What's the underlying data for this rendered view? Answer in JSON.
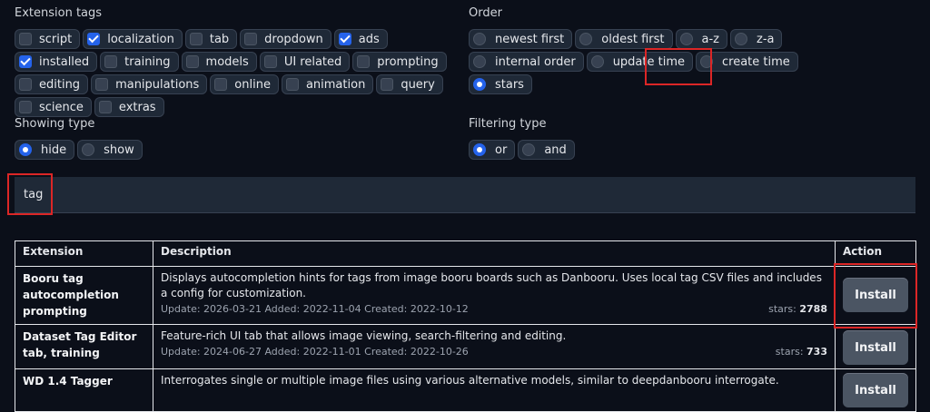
{
  "extension_tags": {
    "label": "Extension tags",
    "rows": [
      [
        {
          "label": "script",
          "checked": false
        },
        {
          "label": "localization",
          "checked": true
        },
        {
          "label": "tab",
          "checked": false
        },
        {
          "label": "dropdown",
          "checked": false
        },
        {
          "label": "ads",
          "checked": true
        },
        {
          "label": "installed",
          "checked": true
        }
      ],
      [
        {
          "label": "training",
          "checked": false
        },
        {
          "label": "models",
          "checked": false
        },
        {
          "label": "UI related",
          "checked": false
        },
        {
          "label": "prompting",
          "checked": false
        },
        {
          "label": "editing",
          "checked": false
        }
      ],
      [
        {
          "label": "manipulations",
          "checked": false
        },
        {
          "label": "online",
          "checked": false
        },
        {
          "label": "animation",
          "checked": false
        },
        {
          "label": "query",
          "checked": false
        },
        {
          "label": "science",
          "checked": false
        },
        {
          "label": "extras",
          "checked": false
        }
      ]
    ]
  },
  "order": {
    "label": "Order",
    "rows": [
      [
        {
          "label": "newest first",
          "selected": false
        },
        {
          "label": "oldest first",
          "selected": false
        },
        {
          "label": "a-z",
          "selected": false
        },
        {
          "label": "z-a",
          "selected": false
        },
        {
          "label": "internal order",
          "selected": false
        }
      ],
      [
        {
          "label": "update time",
          "selected": false
        },
        {
          "label": "create time",
          "selected": false
        },
        {
          "label": "stars",
          "selected": true
        }
      ]
    ]
  },
  "showing_type": {
    "label": "Showing type",
    "options": [
      {
        "label": "hide",
        "selected": true
      },
      {
        "label": "show",
        "selected": false
      }
    ]
  },
  "filtering_type": {
    "label": "Filtering type",
    "options": [
      {
        "label": "or",
        "selected": true
      },
      {
        "label": "and",
        "selected": false
      }
    ]
  },
  "search": {
    "value": "tag"
  },
  "table": {
    "headers": {
      "extension": "Extension",
      "description": "Description",
      "action": "Action"
    },
    "rows": [
      {
        "name": "Booru tag autocompletion prompting",
        "description": "Displays autocompletion hints for tags from image booru boards such as Danbooru. Uses local tag CSV files and includes a config for customization.",
        "dates": "Update: 2026-03-21 Added: 2022-11-04 Created: 2022-10-12",
        "stars_label": "stars:",
        "stars": "2788",
        "action": "Install"
      },
      {
        "name": "Dataset Tag Editor tab, training",
        "description": "Feature-rich UI tab that allows image viewing, search-filtering and editing.",
        "dates": "Update: 2024-06-27 Added: 2022-11-01 Created: 2022-10-26",
        "stars_label": "stars:",
        "stars": "733",
        "action": "Install"
      },
      {
        "name": "WD 1.4 Tagger",
        "description": "Interrogates single or multiple image files using various alternative models, similar to deepdanbooru interrogate.",
        "dates": "",
        "stars_label": "",
        "stars": "",
        "action": "Install"
      }
    ]
  },
  "colors": {
    "accent": "#2563eb",
    "highlight": "#dc2626",
    "background": "#0b0f19",
    "chip": "#1f2937"
  }
}
